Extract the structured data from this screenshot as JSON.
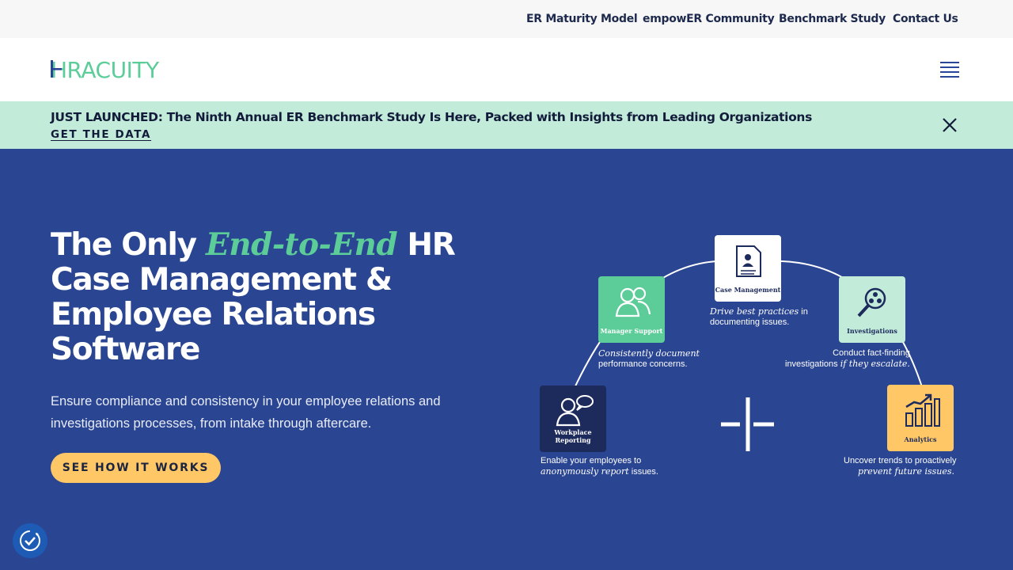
{
  "topnav": {
    "items": [
      "ER Maturity Model",
      "empowER Community",
      "Benchmark Study",
      "Contact Us"
    ]
  },
  "header": {
    "logo_text": "HRACUITY"
  },
  "announcement": {
    "text": "JUST LAUNCHED: The Ninth Annual ER Benchmark Study Is Here, Packed with Insights from Leading Organizations",
    "link": "GET THE DATA"
  },
  "hero": {
    "title_pre": "The Only ",
    "title_highlight": "End-to-End",
    "title_post": " HR Case Management & Employee Relations Software",
    "subtitle": "Ensure compliance and consistency in your employee relations and investigations processes, from intake through aftercare.",
    "cta": "SEE HOW IT WORKS"
  },
  "diagram": {
    "tiles": [
      {
        "label": "Case Management"
      },
      {
        "label": "Manager Support"
      },
      {
        "label": "Investigations"
      },
      {
        "label": "Workplace Reporting"
      },
      {
        "label": "Analytics"
      }
    ],
    "captions": {
      "case": {
        "italic": "Drive best practices",
        "rest": " in",
        "line2": "documenting issues."
      },
      "manager": {
        "italic": "Consistently document",
        "line2": "performance concerns."
      },
      "investigations": {
        "line1": "Conduct fact-finding",
        "line2_pre": "investigations ",
        "italic": "if they escalate."
      },
      "reporting": {
        "line1": "Enable your employees to",
        "italic": "anonymously report",
        "rest": " issues."
      },
      "analytics": {
        "line1": "Uncover trends to proactively",
        "italic": "prevent future issues."
      }
    }
  },
  "colors": {
    "hero_bg": "#2a4592",
    "accent_green": "#5ccc99",
    "cta_yellow": "#ffc766",
    "banner_bg": "#c2ebda",
    "navy": "#1d2a5c"
  }
}
